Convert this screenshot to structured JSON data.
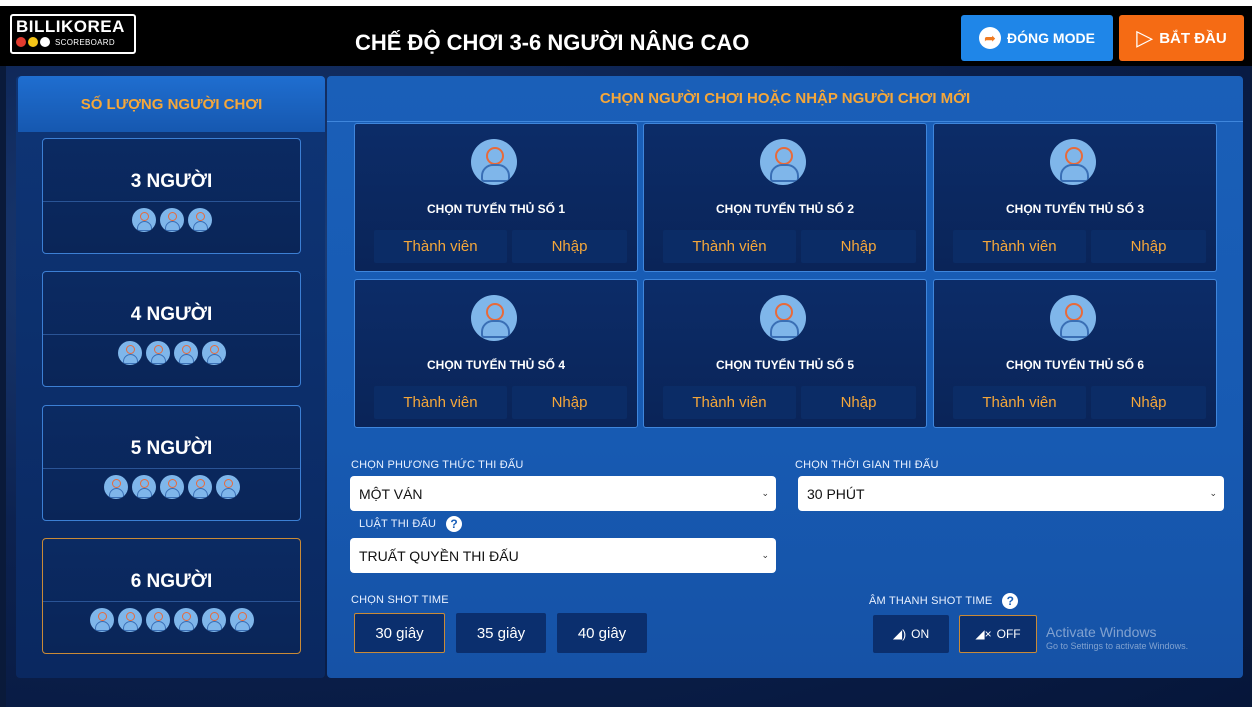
{
  "header": {
    "logo_text": "BILLIKOREA",
    "logo_sub": "SCOREBOARD",
    "title": "CHẾ ĐỘ CHƠI 3-6 NGƯỜI NÂNG CAO",
    "close_mode_label": "ĐÓNG MODE",
    "start_label": "BẮT ĐẦU"
  },
  "left": {
    "heading": "SỐ LƯỢNG NGƯỜI CHƠI",
    "options": [
      {
        "label": "3 NGƯỜI",
        "count": 3,
        "selected": false
      },
      {
        "label": "4 NGƯỜI",
        "count": 4,
        "selected": false
      },
      {
        "label": "5 NGƯỜI",
        "count": 5,
        "selected": false
      },
      {
        "label": "6 NGƯỜI",
        "count": 6,
        "selected": true
      }
    ]
  },
  "right": {
    "heading": "CHỌN NGƯỜI CHƠI HOẶC NHẬP NGƯỜI CHƠI MỚI",
    "slots": [
      {
        "label": "CHỌN TUYỂN THỦ SỐ 1",
        "member": "Thành viên",
        "input": "Nhập"
      },
      {
        "label": "CHỌN TUYỂN THỦ SỐ 2",
        "member": "Thành viên",
        "input": "Nhập"
      },
      {
        "label": "CHỌN TUYỂN THỦ SỐ 3",
        "member": "Thành viên",
        "input": "Nhập"
      },
      {
        "label": "CHỌN TUYỂN THỦ SỐ 4",
        "member": "Thành viên",
        "input": "Nhập"
      },
      {
        "label": "CHỌN TUYỂN THỦ SỐ 5",
        "member": "Thành viên",
        "input": "Nhập"
      },
      {
        "label": "CHỌN TUYỂN THỦ SỐ 6",
        "member": "Thành viên",
        "input": "Nhập"
      }
    ],
    "match_method_label": "CHỌN PHƯƠNG THỨC THI ĐẤU",
    "match_method_value": "MỘT VÁN",
    "match_time_label": "CHỌN THỜI GIAN THI ĐẤU",
    "match_time_value": "30 PHÚT",
    "rule_label": "LUẬT THI ĐẤU",
    "rule_value": "TRUẤT QUYỀN THI ĐẤU",
    "shot_time_label": "CHỌN SHOT TIME",
    "shot_times": [
      "30 giây",
      "35 giây",
      "40 giây"
    ],
    "shot_time_selected": "30 giây",
    "sound_label": "ÂM THANH SHOT TIME",
    "sound_on": "ON",
    "sound_off": "OFF",
    "sound_selected": "OFF"
  },
  "watermark": {
    "line1": "Activate Windows",
    "line2": "Go to Settings to activate Windows."
  },
  "colors": {
    "accent_orange": "#f5a73a",
    "start_button": "#f56b14",
    "close_button": "#1f86e8",
    "panel_blue": "#1a5fb8",
    "selected_border": "#c98a37"
  }
}
